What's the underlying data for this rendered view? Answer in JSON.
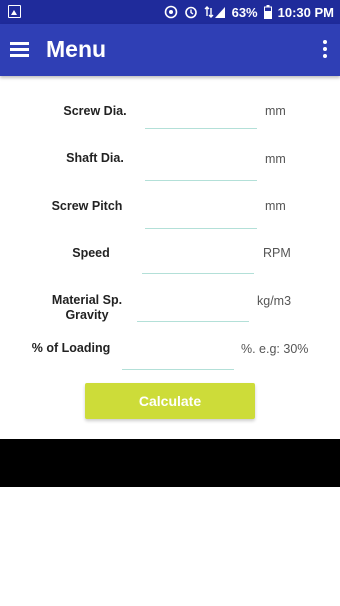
{
  "status_bar": {
    "battery": "63%",
    "time": "10:30 PM"
  },
  "app_bar": {
    "title": "Menu"
  },
  "form": {
    "fields": [
      {
        "label": "Screw Dia.",
        "unit": "mm",
        "value": ""
      },
      {
        "label": "Shaft Dia.",
        "unit": "mm",
        "value": ""
      },
      {
        "label": "Screw Pitch",
        "unit": "mm",
        "value": ""
      },
      {
        "label": "Speed",
        "unit": "RPM",
        "value": ""
      },
      {
        "label": "Material Sp. Gravity",
        "unit": "kg/m3",
        "value": ""
      },
      {
        "label": "% of Loading",
        "unit": "%. e.g: 30%",
        "value": ""
      }
    ],
    "calculate_label": "Calculate"
  },
  "colors": {
    "status_bar": "#1f2b9b",
    "app_bar": "#2f3fb5",
    "button": "#cddc39",
    "input_underline": "#b3e0d8"
  }
}
